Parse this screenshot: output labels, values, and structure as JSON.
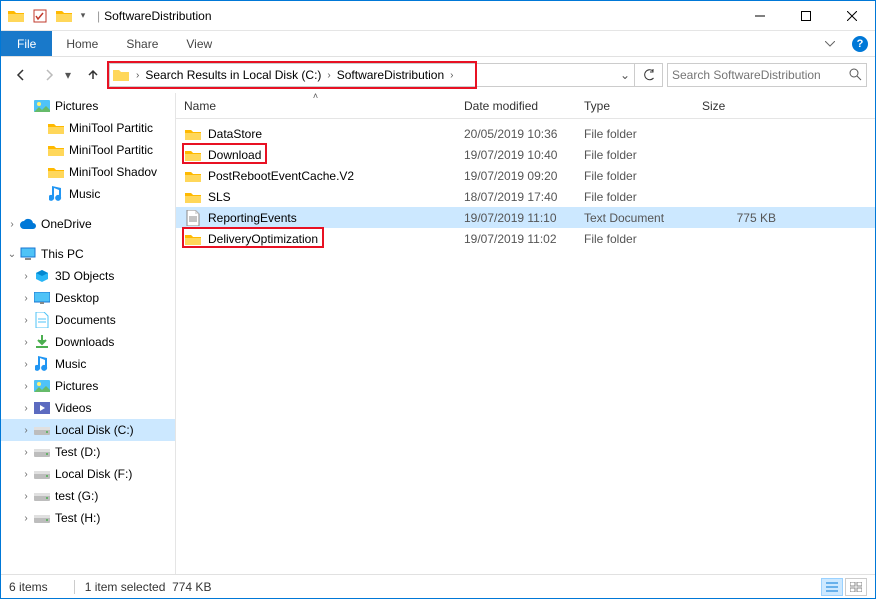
{
  "titlebar": {
    "title": "SoftwareDistribution"
  },
  "ribbon": {
    "file": "File",
    "tabs": [
      "Home",
      "Share",
      "View"
    ]
  },
  "address": {
    "segments": [
      "Search Results in Local Disk (C:)",
      "SoftwareDistribution"
    ]
  },
  "search": {
    "placeholder": "Search SoftwareDistribution"
  },
  "navpane": {
    "items": [
      {
        "indent": 1,
        "icon": "pictures",
        "label": "Pictures",
        "chev": ""
      },
      {
        "indent": 2,
        "icon": "folder",
        "label": "MiniTool Partitic",
        "chev": ""
      },
      {
        "indent": 2,
        "icon": "folder",
        "label": "MiniTool Partitic",
        "chev": ""
      },
      {
        "indent": 2,
        "icon": "folder",
        "label": "MiniTool Shadov",
        "chev": ""
      },
      {
        "indent": 2,
        "icon": "music",
        "label": "Music",
        "chev": ""
      },
      {
        "indent": 0,
        "icon": "",
        "label": "",
        "chev": "",
        "spacer": true
      },
      {
        "indent": 0,
        "icon": "onedrive",
        "label": "OneDrive",
        "chev": ">"
      },
      {
        "indent": 0,
        "icon": "",
        "label": "",
        "chev": "",
        "spacer": true
      },
      {
        "indent": 0,
        "icon": "thispc",
        "label": "This PC",
        "chev": "v"
      },
      {
        "indent": 1,
        "icon": "3dobjects",
        "label": "3D Objects",
        "chev": ">"
      },
      {
        "indent": 1,
        "icon": "desktop",
        "label": "Desktop",
        "chev": ">"
      },
      {
        "indent": 1,
        "icon": "documents",
        "label": "Documents",
        "chev": ">"
      },
      {
        "indent": 1,
        "icon": "downloads",
        "label": "Downloads",
        "chev": ">"
      },
      {
        "indent": 1,
        "icon": "music",
        "label": "Music",
        "chev": ">"
      },
      {
        "indent": 1,
        "icon": "pictures",
        "label": "Pictures",
        "chev": ">"
      },
      {
        "indent": 1,
        "icon": "videos",
        "label": "Videos",
        "chev": ">"
      },
      {
        "indent": 1,
        "icon": "disk",
        "label": "Local Disk (C:)",
        "chev": ">",
        "selected": true
      },
      {
        "indent": 1,
        "icon": "disk",
        "label": "Test (D:)",
        "chev": ">"
      },
      {
        "indent": 1,
        "icon": "disk",
        "label": "Local Disk (F:)",
        "chev": ">"
      },
      {
        "indent": 1,
        "icon": "disk",
        "label": "test (G:)",
        "chev": ">"
      },
      {
        "indent": 1,
        "icon": "disk",
        "label": "Test (H:)",
        "chev": ">"
      }
    ]
  },
  "columns": {
    "name": "Name",
    "date": "Date modified",
    "type": "Type",
    "size": "Size"
  },
  "files": [
    {
      "icon": "folder",
      "name": "DataStore",
      "date": "20/05/2019 10:36",
      "type": "File folder",
      "size": ""
    },
    {
      "icon": "folder",
      "name": "Download",
      "date": "19/07/2019 10:40",
      "type": "File folder",
      "size": "",
      "redbox": true
    },
    {
      "icon": "folder",
      "name": "PostRebootEventCache.V2",
      "date": "19/07/2019 09:20",
      "type": "File folder",
      "size": ""
    },
    {
      "icon": "folder",
      "name": "SLS",
      "date": "18/07/2019 17:40",
      "type": "File folder",
      "size": ""
    },
    {
      "icon": "txt",
      "name": "ReportingEvents",
      "date": "19/07/2019 11:10",
      "type": "Text Document",
      "size": "775 KB",
      "selected": true
    },
    {
      "icon": "folder",
      "name": "DeliveryOptimization",
      "date": "19/07/2019 11:02",
      "type": "File folder",
      "size": "",
      "redbox": true
    }
  ],
  "status": {
    "items": "6 items",
    "selected": "1 item selected",
    "size": "774 KB"
  }
}
